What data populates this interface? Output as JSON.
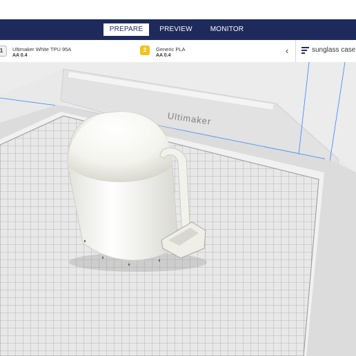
{
  "nav": {
    "tabs": [
      {
        "label": "PREPARE",
        "active": true
      },
      {
        "label": "PREVIEW",
        "active": false
      },
      {
        "label": "MONITOR",
        "active": false
      }
    ]
  },
  "materials": [
    {
      "slot": "1",
      "name": "Ultimaker White TPU 95A",
      "core": "AA 0.4",
      "badge_color": "#f0f0f0"
    },
    {
      "slot": "2",
      "name": "Generic PLA",
      "core": "AA 0.4",
      "badge_color": "#f2c318"
    }
  ],
  "job": {
    "name": "sunglass case -"
  },
  "viewport": {
    "brand": "Ultimaker"
  },
  "colors": {
    "nav_bg": "#1f2a5c",
    "accent_blue": "#3282ff",
    "model_white": "#f4f4f0"
  }
}
